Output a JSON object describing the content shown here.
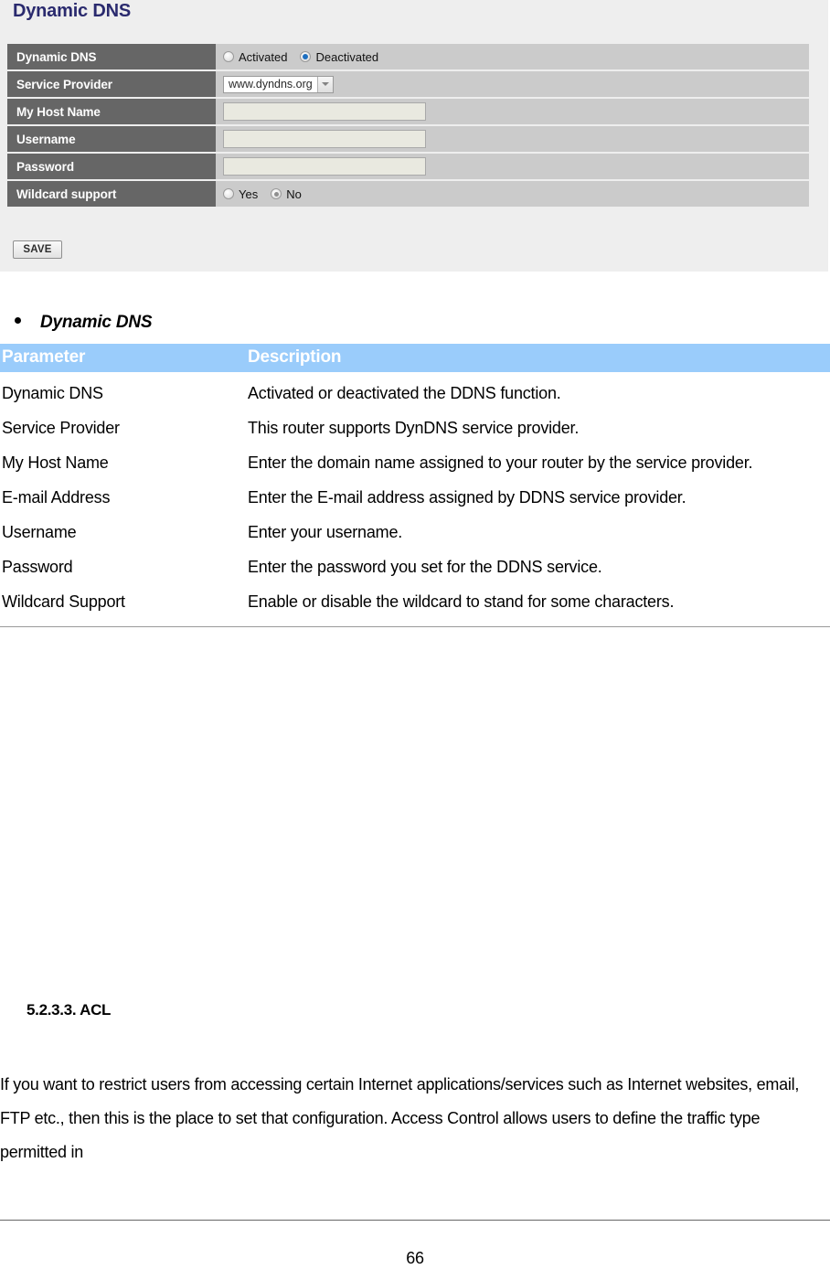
{
  "screenshot": {
    "title": "Dynamic DNS",
    "rows": [
      {
        "label": "Dynamic DNS",
        "type": "radio",
        "options": [
          {
            "label": "Activated",
            "selected": false
          },
          {
            "label": "Deactivated",
            "selected": true
          }
        ]
      },
      {
        "label": "Service Provider",
        "type": "select",
        "value": "www.dyndns.org"
      },
      {
        "label": "My Host Name",
        "type": "text",
        "value": ""
      },
      {
        "label": "Username",
        "type": "text",
        "value": ""
      },
      {
        "label": "Password",
        "type": "text",
        "value": ""
      },
      {
        "label": "Wildcard support",
        "type": "radio",
        "options": [
          {
            "label": "Yes",
            "selected": false
          },
          {
            "label": "No",
            "selected": true
          }
        ]
      }
    ],
    "save_label": "SAVE",
    "colors": {
      "panel_bg": "#eeeeee",
      "label_bg": "#666666",
      "value_bg": "#cbcbcb",
      "input_bg": "#e9e9e0",
      "title_color": "#2a2a6e",
      "radio_selected": "#1d6fc0"
    }
  },
  "document": {
    "bullet_heading": "Dynamic DNS",
    "table": {
      "headers": [
        "Parameter",
        "Description"
      ],
      "header_bg": "#9ACCFB",
      "rows": [
        {
          "parameter": "Dynamic DNS",
          "description": "Activated or deactivated the DDNS function."
        },
        {
          "parameter": "Service Provider",
          "description": "This router supports DynDNS service provider."
        },
        {
          "parameter": "My Host Name",
          "description": "Enter the domain name assigned to your router by the service provider."
        },
        {
          "parameter": "E-mail Address",
          "description": "Enter the E-mail address assigned by DDNS service provider."
        },
        {
          "parameter": "Username",
          "description": "Enter your username."
        },
        {
          "parameter": "Password",
          "description": "Enter the password you set for the DDNS service."
        },
        {
          "parameter": "Wildcard Support",
          "description": "Enable or disable the wildcard to stand for some characters."
        }
      ]
    },
    "section_heading": "5.2.3.3. ACL",
    "paragraph": "If you want to restrict users from accessing certain Internet applications/services such as Internet websites, email, FTP etc., then this is the place to set that configuration. Access Control allows users to define the traffic type permitted in",
    "page_number": "66"
  }
}
